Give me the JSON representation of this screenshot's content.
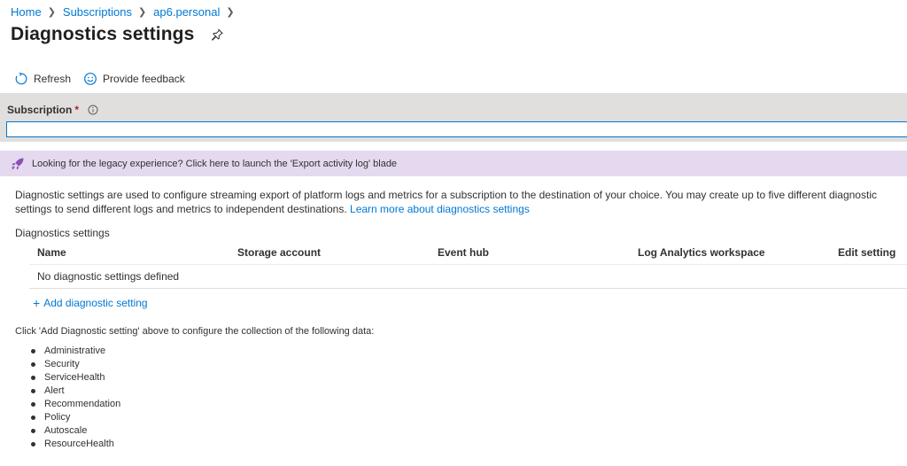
{
  "breadcrumb": {
    "items": [
      "Home",
      "Subscriptions",
      "ap6.personal"
    ]
  },
  "header": {
    "title": "Diagnostics settings"
  },
  "toolbar": {
    "refresh_label": "Refresh",
    "feedback_label": "Provide feedback"
  },
  "subscription": {
    "label": "Subscription",
    "required_marker": "*",
    "value": ""
  },
  "banner": {
    "text": "Looking for the legacy experience? Click here to launch the 'Export activity log' blade",
    "bg_color": "#e5d9ef"
  },
  "description": {
    "text": "Diagnostic settings are used to configure streaming export of platform logs and metrics for a subscription to the destination of your choice. You may create up to five different diagnostic settings to send different logs and metrics to independent destinations.",
    "link": "Learn more about diagnostics settings"
  },
  "table": {
    "section_label": "Diagnostics settings",
    "columns": [
      "Name",
      "Storage account",
      "Event hub",
      "Log Analytics workspace",
      "Edit setting"
    ],
    "empty_text": "No diagnostic settings defined"
  },
  "add_setting_label": "Add diagnostic setting",
  "note": "Click 'Add Diagnostic setting' above to configure the collection of the following data:",
  "data_categories": [
    "Administrative",
    "Security",
    "ServiceHealth",
    "Alert",
    "Recommendation",
    "Policy",
    "Autoscale",
    "ResourceHealth"
  ],
  "colors": {
    "accent": "#0078d4",
    "band": "#e1dfdd",
    "required": "#a4262c"
  }
}
